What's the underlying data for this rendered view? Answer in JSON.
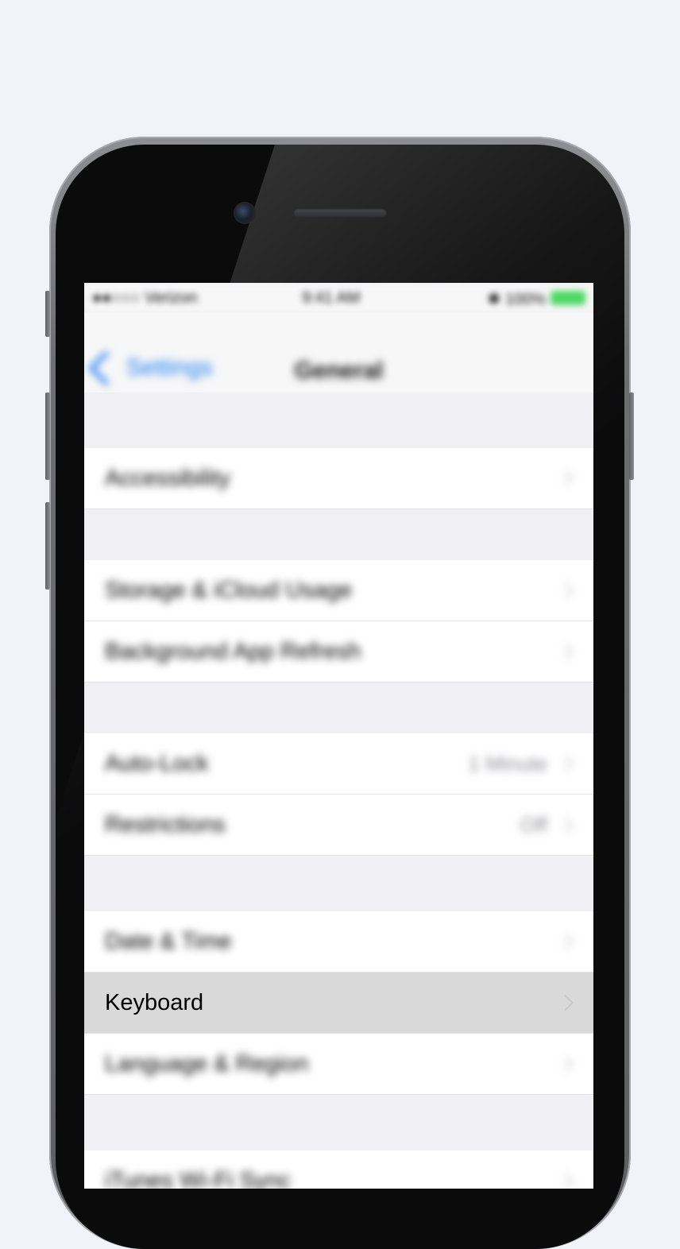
{
  "status_bar": {
    "carrier": "●●○○○ Verizon",
    "time": "9:41 AM",
    "battery_text": "✱ 100%",
    "battery_color": "#4cd964"
  },
  "nav": {
    "back_label": "Settings",
    "title": "General"
  },
  "rows": {
    "accessibility": {
      "label": "Accessibility"
    },
    "storage": {
      "label": "Storage & iCloud Usage"
    },
    "background_refresh": {
      "label": "Background App Refresh"
    },
    "auto_lock": {
      "label": "Auto-Lock",
      "value": "1 Minute"
    },
    "restrictions": {
      "label": "Restrictions",
      "value": "Off"
    },
    "date_time": {
      "label": "Date & Time"
    },
    "keyboard": {
      "label": "Keyboard"
    },
    "language_region": {
      "label": "Language & Region"
    },
    "itunes_sync": {
      "label": "iTunes Wi-Fi Sync"
    }
  },
  "colors": {
    "accent": "#1a7cf4",
    "highlight_row": "#d9d9d9",
    "page_background": "#f2f3f8"
  }
}
